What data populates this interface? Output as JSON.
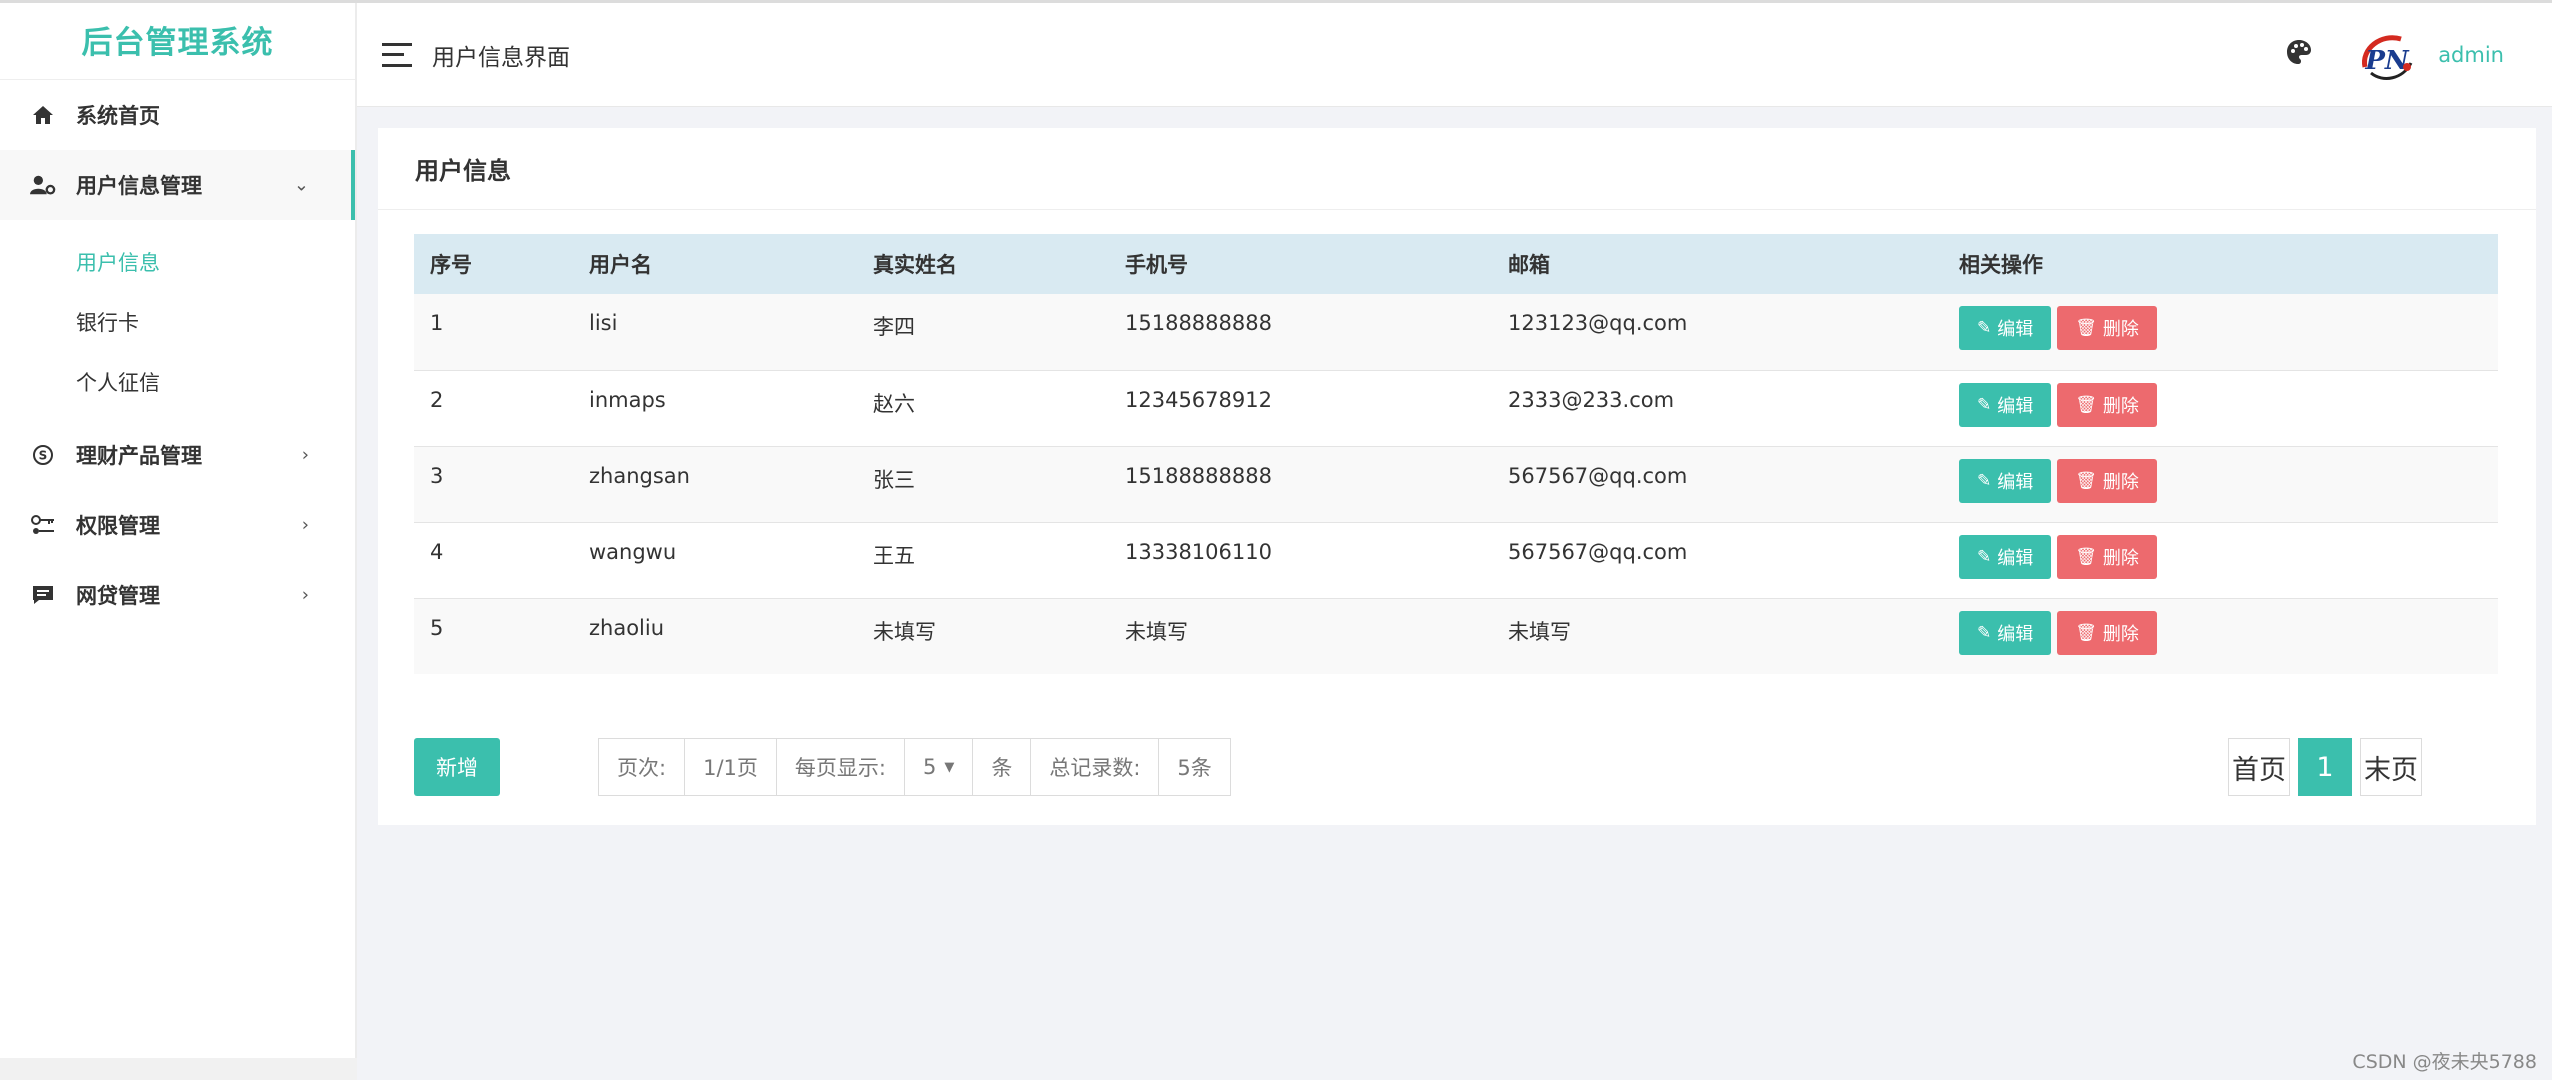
{
  "app": {
    "brand": "后台管理系统"
  },
  "sidebar": {
    "items": [
      {
        "label": "系统首页",
        "icon": "home-icon"
      },
      {
        "label": "用户信息管理",
        "icon": "user-settings-icon",
        "expanded": true,
        "children": [
          {
            "label": "用户信息"
          },
          {
            "label": "银行卡"
          },
          {
            "label": "个人征信"
          }
        ]
      },
      {
        "label": "理财产品管理",
        "icon": "coin-icon"
      },
      {
        "label": "权限管理",
        "icon": "key-icon"
      },
      {
        "label": "网贷管理",
        "icon": "message-icon"
      }
    ]
  },
  "header": {
    "title": "用户信息界面",
    "username": "admin"
  },
  "panel": {
    "title": "用户信息",
    "columns": [
      "序号",
      "用户名",
      "真实姓名",
      "手机号",
      "邮箱",
      "相关操作"
    ],
    "rows": [
      {
        "id": "1",
        "username": "lisi",
        "realname": "李四",
        "phone": "15188888888",
        "email": "123123@qq.com"
      },
      {
        "id": "2",
        "username": "inmaps",
        "realname": "赵六",
        "phone": "12345678912",
        "email": "2333@233.com"
      },
      {
        "id": "3",
        "username": "zhangsan",
        "realname": "张三",
        "phone": "15188888888",
        "email": "567567@qq.com"
      },
      {
        "id": "4",
        "username": "wangwu",
        "realname": "王五",
        "phone": "13338106110",
        "email": "567567@qq.com"
      },
      {
        "id": "5",
        "username": "zhaoliu",
        "realname": "未填写",
        "phone": "未填写",
        "email": "未填写"
      }
    ],
    "edit_label": "编辑",
    "delete_label": "删除",
    "add_label": "新增"
  },
  "pagination": {
    "page_label": "页次:",
    "page_value": "1/1页",
    "per_page_label": "每页显示:",
    "per_page_value": "5",
    "per_page_unit": "条",
    "total_label": "总记录数:",
    "total_value": "5条",
    "first": "首页",
    "current": "1",
    "last": "末页"
  },
  "watermark": "CSDN @夜未央5788",
  "colors": {
    "accent": "#3bbfad",
    "danger": "#ed6a6e",
    "table_header": "#d9eaf2"
  }
}
